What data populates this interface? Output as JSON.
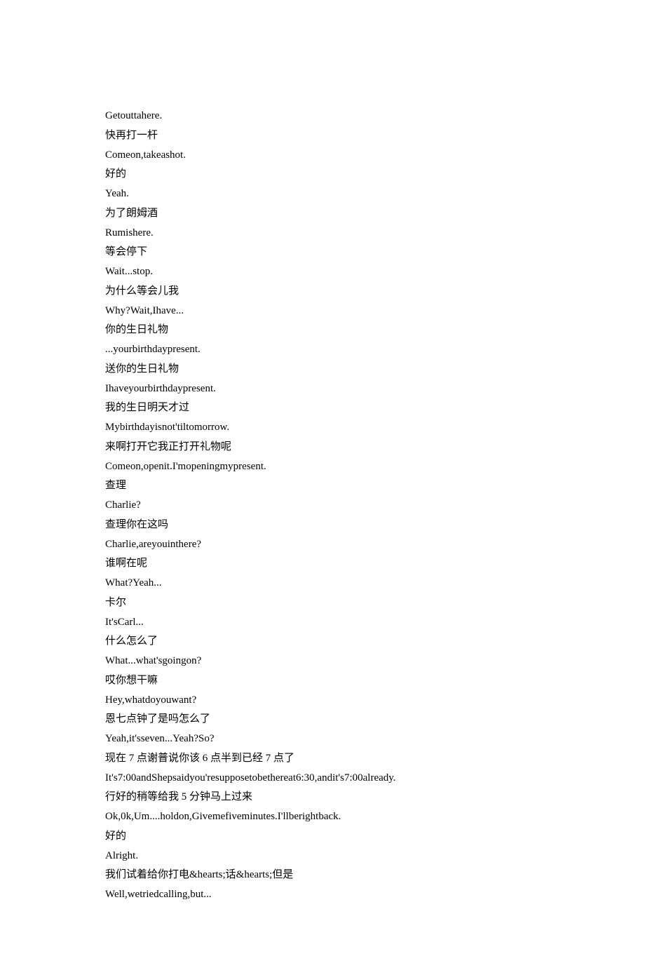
{
  "lines": [
    "Getouttahere.",
    "快再打一杆",
    "Comeon,takeashot.",
    "好的",
    "Yeah.",
    "为了朗姆酒",
    "Rumishere.",
    "等会停下",
    "Wait...stop.",
    "为什么等会儿我",
    "Why?Wait,Ihave...",
    "你的生日礼物",
    "...yourbirthdaypresent.",
    "送你的生日礼物",
    "Ihaveyourbirthdaypresent.",
    "我的生日明天才过",
    "Mybirthdayisnot'tiltomorrow.",
    "来啊打开它我正打开礼物呢",
    "Comeon,openit.I'mopeningmypresent.",
    "查理",
    "Charlie?",
    "查理你在这吗",
    "Charlie,areyouinthere?",
    "谁啊在呢",
    "What?Yeah...",
    "卡尔",
    "It'sCarl...",
    "什么怎么了",
    "What...what'sgoingon?",
    "哎你想干嘛",
    "Hey,whatdoyouwant?",
    "恩七点钟了是吗怎么了",
    "Yeah,it'sseven...Yeah?So?",
    "现在 7 点谢普说你该 6 点半到已经 7 点了",
    "It's7:00andShepsaidyou'resupposetobethereat6:30,andit's7:00already.",
    "行好的稍等给我 5 分钟马上过来",
    "Ok,0k,Um....holdon,Givemefiveminutes.I'llberightback.",
    "好的",
    "Alright.",
    "我们试着给你打电&hearts;话&hearts;但是",
    "Well,wetriedcalling,but..."
  ]
}
